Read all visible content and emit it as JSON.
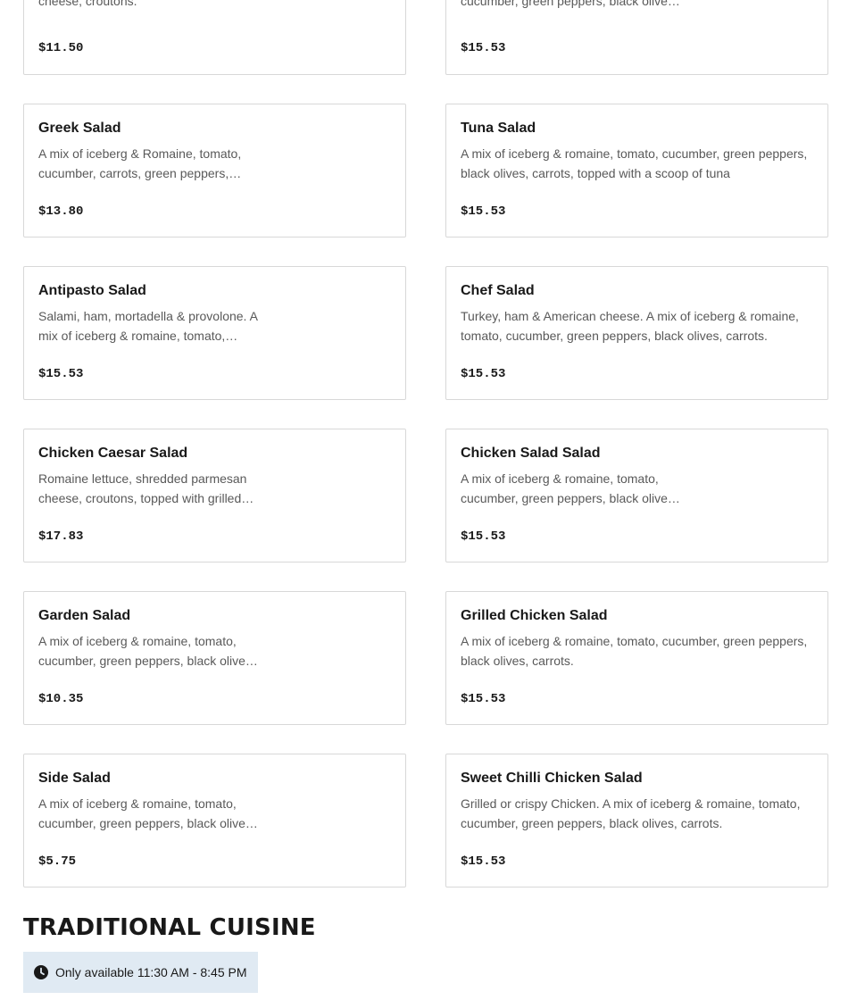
{
  "menu_items": [
    {
      "name": "",
      "description": "cheese, croutons.",
      "price": "$11.50"
    },
    {
      "name": "",
      "description": "cucumber, green peppers, black olive…",
      "price": "$15.53"
    },
    {
      "name": "Greek Salad",
      "description": "A mix of iceberg & Romaine, tomato, cucumber, carrots, green peppers,…",
      "price": "$13.80"
    },
    {
      "name": "Tuna Salad",
      "description": "A mix of iceberg & romaine, tomato, cucumber, green peppers, black olives, carrots, topped with a scoop of tuna",
      "price": "$15.53"
    },
    {
      "name": "Antipasto Salad",
      "description": "Salami, ham, mortadella & provolone. A mix of iceberg & romaine, tomato,…",
      "price": "$15.53"
    },
    {
      "name": "Chef Salad",
      "description": "Turkey, ham & American cheese. A mix of iceberg & romaine, tomato, cucumber, green peppers, black olives, carrots.",
      "price": "$15.53"
    },
    {
      "name": "Chicken Caesar Salad",
      "description": "Romaine lettuce, shredded parmesan cheese, croutons, topped with grilled…",
      "price": "$17.83"
    },
    {
      "name": "Chicken Salad Salad",
      "description": "A mix of iceberg & romaine, tomato, cucumber, green peppers, black olive…",
      "price": "$15.53"
    },
    {
      "name": "Garden Salad",
      "description": "A mix of iceberg & romaine, tomato, cucumber, green peppers, black olive…",
      "price": "$10.35"
    },
    {
      "name": "Grilled Chicken Salad",
      "description": "A mix of iceberg & romaine, tomato, cucumber, green peppers, black olives, carrots.",
      "price": "$15.53"
    },
    {
      "name": "Side Salad",
      "description": "A mix of iceberg & romaine, tomato, cucumber, green peppers, black olive…",
      "price": "$5.75"
    },
    {
      "name": "Sweet Chilli Chicken Salad",
      "description": "Grilled or crispy Chicken. A mix of iceberg & romaine, tomato, cucumber, green peppers, black olives, carrots.",
      "price": "$15.53"
    }
  ],
  "section": {
    "title": "TRADITIONAL CUISINE",
    "availability": "Only available 11:30 AM - 8:45 PM",
    "availability_icon": "clock-icon"
  }
}
